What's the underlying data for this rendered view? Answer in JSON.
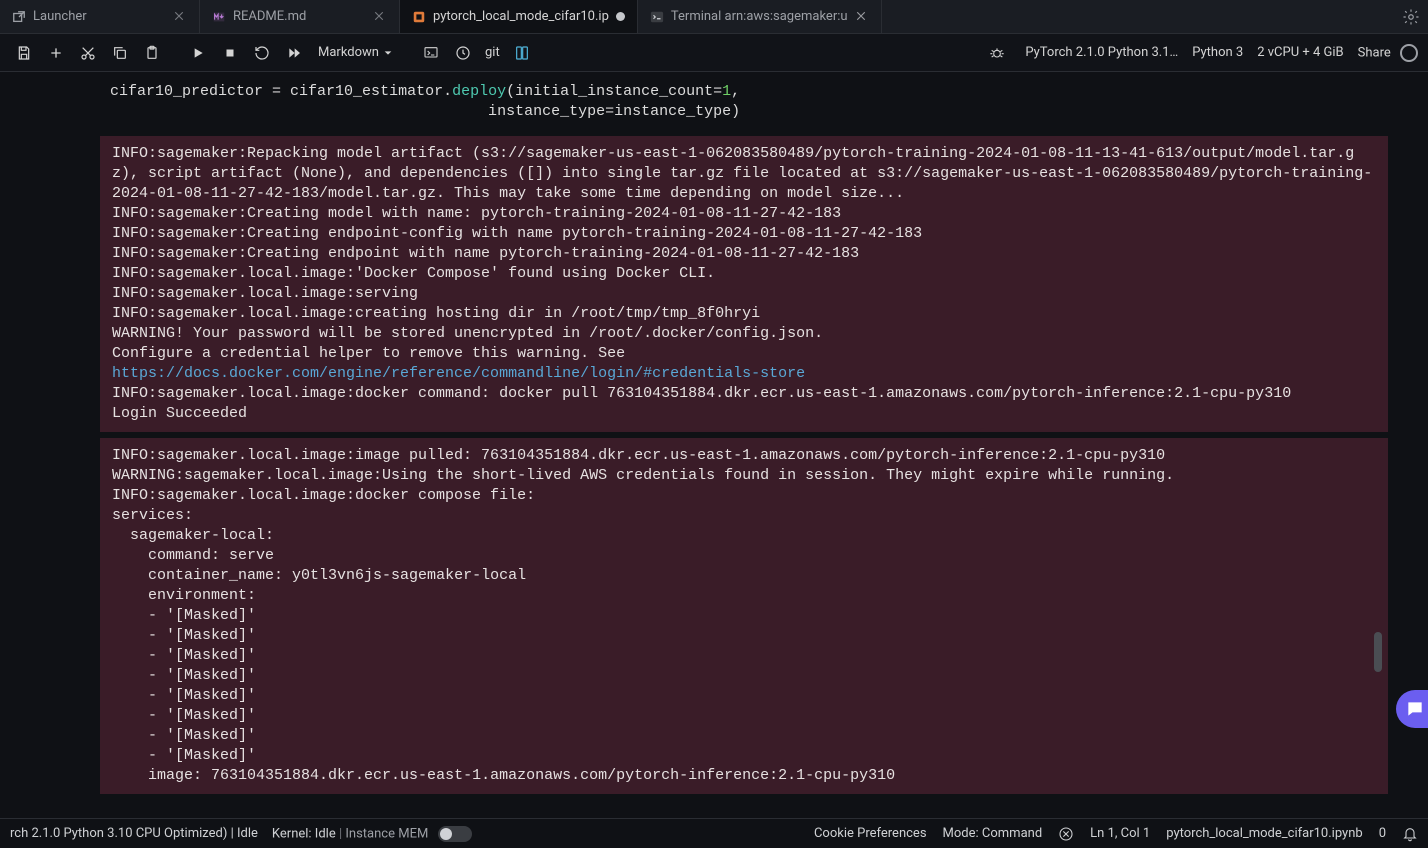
{
  "tabs": [
    {
      "label": "Launcher",
      "icon": "external-link-icon",
      "closeable": true
    },
    {
      "label": "README.md",
      "icon": "markdown-icon",
      "closeable": true
    },
    {
      "label": "pytorch_local_mode_cifar10.ip",
      "icon": "notebook-icon",
      "modified": true,
      "active": true
    },
    {
      "label": "Terminal arn:aws:sagemaker:u",
      "icon": "terminal-icon",
      "closeable": true
    }
  ],
  "toolbar": {
    "cell_type": "Markdown",
    "git_label": "git",
    "cluster": "PyTorch 2.1.0 Python 3.1…",
    "kernel": "Python 3",
    "instance": "2 vCPU + 4 GiB",
    "share": "Share"
  },
  "code": {
    "line1_a": "cifar10_predictor ",
    "line1_eq": "=",
    "line1_b": " cifar10_estimator.",
    "line1_fn": "deploy",
    "line1_c": "(initial_instance_count",
    "line1_eq2": "=",
    "line1_num": "1",
    "line1_comma": ",",
    "line2_pad": "                                          instance_type",
    "line2_eq": "=",
    "line2_b": "instance_type)"
  },
  "output1": "INFO:sagemaker:Repacking model artifact (s3://sagemaker-us-east-1-062083580489/pytorch-training-2024-01-08-11-13-41-613/output/model.tar.gz), script artifact (None), and dependencies ([]) into single tar.gz file located at s3://sagemaker-us-east-1-062083580489/pytorch-training-2024-01-08-11-27-42-183/model.tar.gz. This may take some time depending on model size...\nINFO:sagemaker:Creating model with name: pytorch-training-2024-01-08-11-27-42-183\nINFO:sagemaker:Creating endpoint-config with name pytorch-training-2024-01-08-11-27-42-183\nINFO:sagemaker:Creating endpoint with name pytorch-training-2024-01-08-11-27-42-183\nINFO:sagemaker.local.image:'Docker Compose' found using Docker CLI.\nINFO:sagemaker.local.image:serving\nINFO:sagemaker.local.image:creating hosting dir in /root/tmp/tmp_8f0hryi\nWARNING! Your password will be stored unencrypted in /root/.docker/config.json.\nConfigure a credential helper to remove this warning. See",
  "output1_link": "https://docs.docker.com/engine/reference/commandline/login/#credentials-store",
  "output1_tail": "\nINFO:sagemaker.local.image:docker command: docker pull 763104351884.dkr.ecr.us-east-1.amazonaws.com/pytorch-inference:2.1-cpu-py310\nLogin Succeeded",
  "output2": "INFO:sagemaker.local.image:image pulled: 763104351884.dkr.ecr.us-east-1.amazonaws.com/pytorch-inference:2.1-cpu-py310\nWARNING:sagemaker.local.image:Using the short-lived AWS credentials found in session. They might expire while running.\nINFO:sagemaker.local.image:docker compose file: \nservices:\n  sagemaker-local:\n    command: serve\n    container_name: y0tl3vn6js-sagemaker-local\n    environment:\n    - '[Masked]'\n    - '[Masked]'\n    - '[Masked]'\n    - '[Masked]'\n    - '[Masked]'\n    - '[Masked]'\n    - '[Masked]'\n    - '[Masked]'\n    image: 763104351884.dkr.ecr.us-east-1.amazonaws.com/pytorch-inference:2.1-cpu-py310",
  "status": {
    "left1": "rch 2.1.0 Python 3.10 CPU Optimized) | Idle",
    "kernel": "Kernel: Idle",
    "mem_label": "Instance MEM",
    "cookie": "Cookie Preferences",
    "mode": "Mode: Command",
    "cursor": "Ln 1, Col 1",
    "file": "pytorch_local_mode_cifar10.ipynb",
    "notif": "0"
  }
}
